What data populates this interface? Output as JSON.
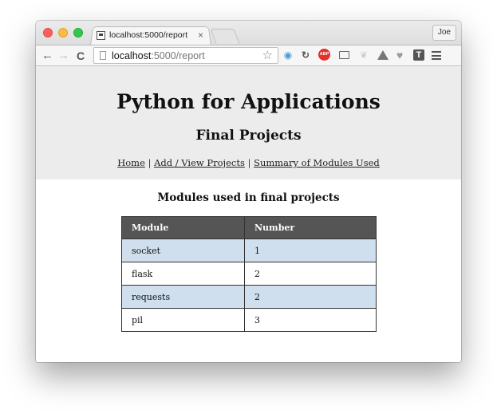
{
  "browser": {
    "tab_title": "localhost:5000/report",
    "tab_close": "×",
    "profile_name": "Joe",
    "url_host": "localhost",
    "url_path": ":5000/report",
    "nav_back": "←",
    "nav_forward": "→",
    "nav_reload": "C",
    "star": "☆",
    "extensions": [
      "camera-icon",
      "sync-icon",
      "adblock-icon",
      "cast-icon",
      "leaf-icon",
      "drive-icon",
      "heart-icon",
      "t-icon",
      "menu-icon"
    ],
    "ext_abp_label": "ABP",
    "ext_t_label": "T"
  },
  "page": {
    "title": "Python for Applications",
    "subtitle": "Final Projects",
    "nav_links": [
      {
        "label": "Home"
      },
      {
        "label": "Add / View Projects"
      },
      {
        "label": "Summary of Modules Used"
      }
    ],
    "nav_separator": "|",
    "section_heading": "Modules used in final projects",
    "table": {
      "headers": [
        "Module",
        "Number"
      ],
      "rows": [
        [
          "socket",
          "1"
        ],
        [
          "flask",
          "2"
        ],
        [
          "requests",
          "2"
        ],
        [
          "pil",
          "3"
        ]
      ]
    }
  },
  "colors": {
    "banner_bg": "#ececec",
    "table_header_bg": "#555555",
    "row_highlight": "#cfdfee"
  }
}
